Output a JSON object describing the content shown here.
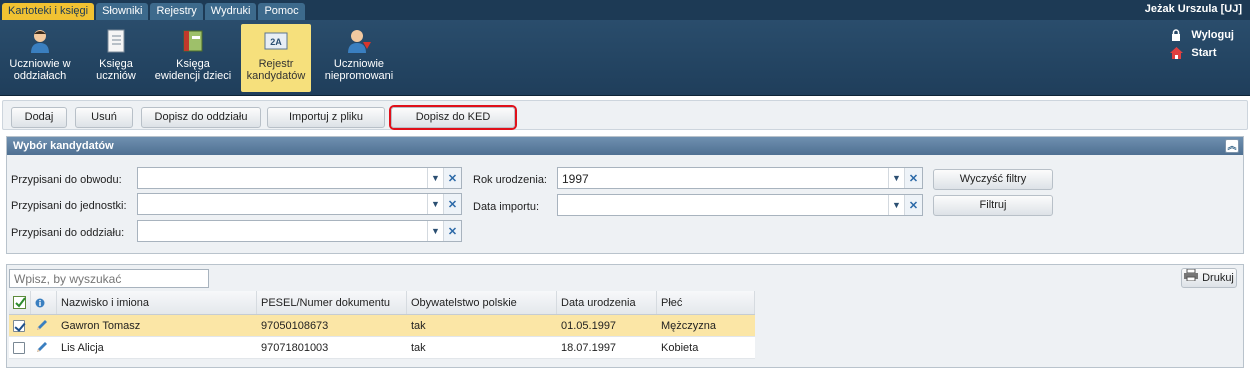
{
  "menu": {
    "tabs": [
      {
        "label": "Kartoteki i księgi",
        "active": true
      },
      {
        "label": "Słowniki",
        "active": false
      },
      {
        "label": "Rejestry",
        "active": false
      },
      {
        "label": "Wydruki",
        "active": false
      },
      {
        "label": "Pomoc",
        "active": false
      }
    ],
    "user": "Jeżak Urszula [UJ]"
  },
  "ribbon": {
    "items": [
      {
        "label": "Uczniowie w oddziałach",
        "icon": "student-icon"
      },
      {
        "label": "Księga uczniów",
        "icon": "book-icon"
      },
      {
        "label": "Księga ewidencji dzieci",
        "icon": "ledger-icon"
      },
      {
        "label": "Rejestr kandydatów",
        "icon": "register-icon",
        "active": true
      },
      {
        "label": "Uczniowie niepromowani",
        "icon": "student-down-icon"
      }
    ],
    "side": {
      "logout": "Wyloguj",
      "start": "Start"
    }
  },
  "toolbar": {
    "add": "Dodaj",
    "remove": "Usuń",
    "assign_class": "Dopisz do oddziału",
    "import": "Importuj z pliku",
    "assign_ked": "Dopisz do KED"
  },
  "filters": {
    "title": "Wybór kandydatów",
    "district_label": "Przypisani do obwodu:",
    "unit_label": "Przypisani do jednostki:",
    "class_label": "Przypisani do oddziału:",
    "birth_year_label": "Rok urodzenia:",
    "birth_year_value": "1997",
    "import_date_label": "Data importu:",
    "clear_button": "Wyczyść filtry",
    "filter_button": "Filtruj"
  },
  "grid": {
    "search_placeholder": "Wpisz, by wyszukać",
    "print": "Drukuj",
    "columns": [
      "Nazwisko i imiona",
      "PESEL/Numer dokumentu",
      "Obywatelstwo polskie",
      "Data urodzenia",
      "Płeć"
    ],
    "rows": [
      {
        "name": "Gawron Tomasz",
        "pesel": "97050108673",
        "citizen": "tak",
        "birth": "01.05.1997",
        "sex": "Mężczyzna",
        "checked": true
      },
      {
        "name": "Lis Alicja",
        "pesel": "97071801003",
        "citizen": "tak",
        "birth": "18.07.1997",
        "sex": "Kobieta",
        "checked": false
      }
    ]
  },
  "colors": {
    "menubar": "#1d3a55",
    "active_tab": "#f1c232",
    "ribbon_active": "#f6e07c",
    "selected_row": "#fbe6a6",
    "highlight": "#e0101a"
  }
}
